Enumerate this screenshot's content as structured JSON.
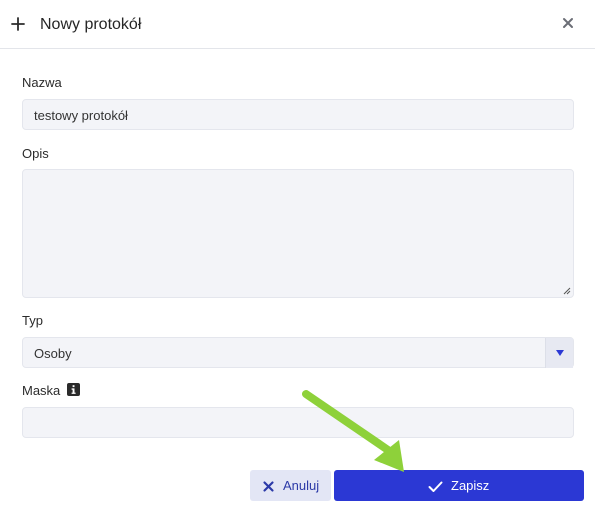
{
  "dialog": {
    "title": "Nowy protokół",
    "close_icon": "close-icon",
    "header_icon": "plus-icon"
  },
  "form": {
    "name": {
      "label": "Nazwa",
      "value": "testowy protokół"
    },
    "description": {
      "label": "Opis",
      "value": ""
    },
    "type": {
      "label": "Typ",
      "selected": "Osoby"
    },
    "mask": {
      "label": "Maska",
      "value": "",
      "info_icon": "info-icon"
    }
  },
  "buttons": {
    "cancel_label": "Anuluj",
    "save_label": "Zapisz"
  },
  "colors": {
    "accent": "#2b38d4",
    "cancel_bg": "#e3e6f5",
    "field_bg": "#f3f4f8",
    "annotation_arrow": "#8ed13a"
  }
}
